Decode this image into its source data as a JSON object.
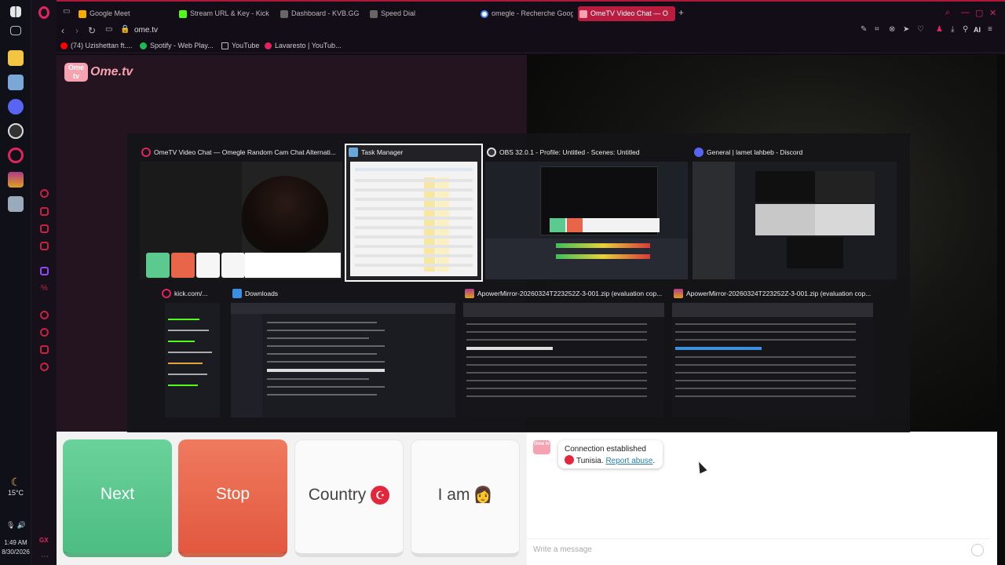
{
  "taskbar": {
    "weather_temp": "15°C",
    "time": "1:49 AM",
    "date": "8/30/2026",
    "gx_label": "GX"
  },
  "browser": {
    "tabs": [
      {
        "label": "Google Meet",
        "color": "#f9ab00"
      },
      {
        "label": "Stream URL & Key - Kick D",
        "color": "#53fc18"
      },
      {
        "label": "Dashboard - KVB.GG",
        "color": "#888888"
      },
      {
        "label": "Speed Dial",
        "color": "#888888"
      },
      {
        "label": "omegle - Recherche Googl",
        "color": "#4285f4"
      },
      {
        "label": "OmeTV Video Chat — O",
        "color": "#f6a2b0",
        "active": true
      }
    ],
    "url": "ome.tv",
    "ai_label": "AI",
    "bookmarks": [
      {
        "label": "(74) Uzishettan ft....",
        "color": "#ff0000"
      },
      {
        "label": "Spotify - Web Play...",
        "color": "#1db954"
      },
      {
        "label": "YouTube",
        "color": "#bbbbbb"
      },
      {
        "label": "Lavaresto | YouTub...",
        "color": "#e0245e"
      }
    ]
  },
  "page": {
    "logo_badge": "Ome tv",
    "logo_text": "Ome.tv"
  },
  "switcher": {
    "windows": [
      {
        "title": "OmeTV Video Chat — Omegle Random Cam Chat Alternati...",
        "icon": "opera-icon"
      },
      {
        "title": "Task Manager",
        "icon": "task-manager-icon"
      },
      {
        "title": "OBS 32.0.1 - Profile: Untitled - Scenes: Untitled",
        "icon": "obs-icon"
      },
      {
        "title": "General | lamet lahbeb - Discord",
        "icon": "discord-icon"
      },
      {
        "title": "kick.com/...",
        "icon": "opera-icon"
      },
      {
        "title": "Downloads",
        "icon": "downloads-icon"
      },
      {
        "title": "ApowerMirror-20260324T223252Z-3-001.zip (evaluation cop...",
        "icon": "winrar-icon"
      },
      {
        "title": "ApowerMirror-20260324T223252Z-3-001.zip (evaluation cop...",
        "icon": "winrar-icon"
      }
    ]
  },
  "controls": {
    "next": "Next",
    "stop": "Stop",
    "country": "Country",
    "i_am": "I am",
    "iam_emoji": "👩"
  },
  "chat": {
    "avatar_label": "Ome tv",
    "status": "Connection established",
    "country": "Tunisia.",
    "report": "Report abuse",
    "report_suffix": ".",
    "placeholder": "Write a message"
  }
}
